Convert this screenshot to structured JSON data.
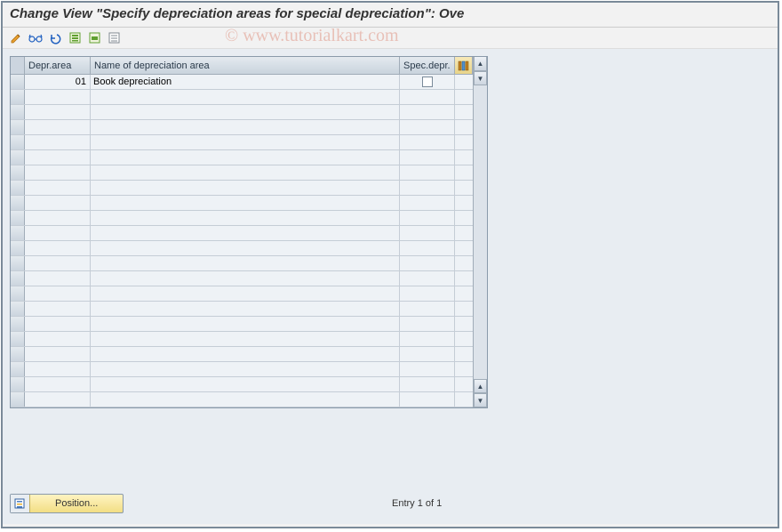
{
  "title": "Change View \"Specify depreciation areas for special depreciation\": Ove",
  "watermark": "© www.tutorialkart.com",
  "toolbar": {
    "items": [
      {
        "name": "change-icon"
      },
      {
        "name": "glasses-icon"
      },
      {
        "name": "undo-icon"
      },
      {
        "name": "select-all-icon"
      },
      {
        "name": "select-block-icon"
      },
      {
        "name": "deselect-all-icon"
      }
    ]
  },
  "table": {
    "columns": {
      "depr_area": "Depr.area",
      "name": "Name of depreciation area",
      "spec_depr": "Spec.depr."
    },
    "rows": [
      {
        "depr_area": "01",
        "name": "Book depreciation",
        "spec_depr": false
      }
    ],
    "empty_rows": 21
  },
  "footer": {
    "position_label": "Position...",
    "entry_text": "Entry 1 of 1"
  }
}
